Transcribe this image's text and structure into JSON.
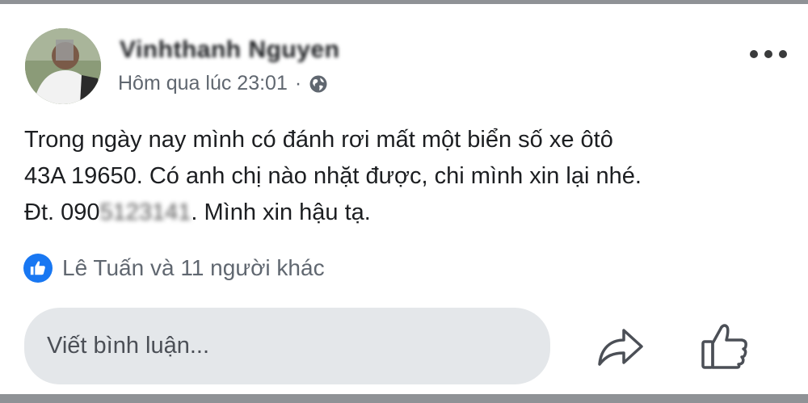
{
  "post": {
    "author": "Vinhthanh Nguyen",
    "timestamp": "Hôm qua lúc 23:01",
    "separator": "·",
    "privacy_icon": "globe-icon",
    "body": {
      "line1": "Trong ngày nay mình có đánh rơi mất một biển số xe ôtô",
      "line2": "43A 19650. Có anh chị nào nhặt được, chi mình xin lại nhé.",
      "line3_prefix": "Đt. 090",
      "line3_phone_blurred": "5123141",
      "line3_suffix": ". Mình xin hậu tạ."
    },
    "reactions": {
      "icon": "like-icon",
      "text": "Lê Tuấn và 11 người khác"
    }
  },
  "actions": {
    "comment_placeholder": "Viết bình luận...",
    "share_icon": "share-icon",
    "like_icon": "thumbs-up-icon"
  },
  "colors": {
    "like_blue": "#1877f2",
    "comment_bg": "#e4e7ea",
    "meta_gray": "#606770",
    "frame_gray": "#8f9296"
  }
}
